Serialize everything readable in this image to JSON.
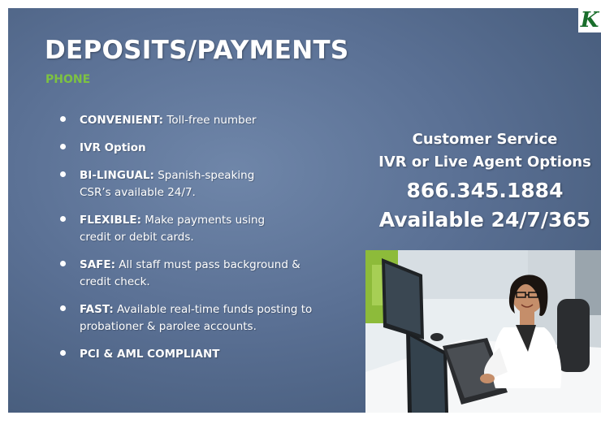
{
  "slide": {
    "logo_letter": "K",
    "title": "DEPOSITS/PAYMENTS",
    "subtitle": "PHONE",
    "bullets": [
      {
        "bold": "CONVENIENT:",
        "text": " Toll-free number"
      },
      {
        "bold": "IVR Option",
        "text": ""
      },
      {
        "bold": "BI-LINGUAL:",
        "text": " Spanish-speaking CSR’s available 24/7."
      },
      {
        "bold": "FLEXIBLE:",
        "text": " Make payments using credit or debit cards."
      },
      {
        "bold": "SAFE:",
        "text": " All staff must pass background & credit check."
      },
      {
        "bold": "FAST:",
        "text": "  Available real-time funds posting to probationer & parolee accounts."
      },
      {
        "bold": "PCI & AML COMPLIANT",
        "text": ""
      }
    ],
    "customer_service": {
      "line1": "Customer Service",
      "line2": "IVR or Live Agent Options",
      "phone": "866.345.1884",
      "availability": "Available 24/7/365"
    }
  },
  "colors": {
    "background": "#5a7094",
    "subtitle": "#7dc242",
    "text": "#ffffff",
    "logo": "#1a6e2c"
  }
}
